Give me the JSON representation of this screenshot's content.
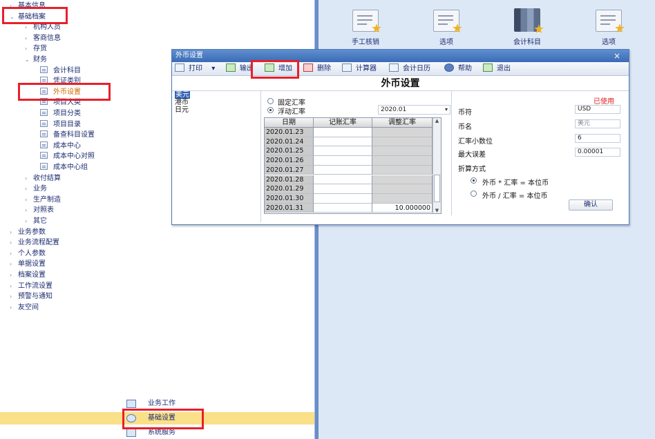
{
  "nav": {
    "items": [
      {
        "label": "基本信息",
        "level": 0,
        "arrow": "›"
      },
      {
        "label": "基础档案",
        "level": 0,
        "arrow": "⌄"
      },
      {
        "label": "机构人员",
        "level": 1,
        "arrow": "›"
      },
      {
        "label": "客商信息",
        "level": 1,
        "arrow": "›"
      },
      {
        "label": "存货",
        "level": 1,
        "arrow": "›"
      },
      {
        "label": "财务",
        "level": 1,
        "arrow": "⌄"
      },
      {
        "label": "会计科目",
        "level": 2
      },
      {
        "label": "凭证类别",
        "level": 2
      },
      {
        "label": "外币设置",
        "level": 2,
        "active": true
      },
      {
        "label": "项目大类",
        "level": 2
      },
      {
        "label": "项目分类",
        "level": 2
      },
      {
        "label": "项目目录",
        "level": 2
      },
      {
        "label": "备查科目设置",
        "level": 2
      },
      {
        "label": "成本中心",
        "level": 2
      },
      {
        "label": "成本中心对照",
        "level": 2
      },
      {
        "label": "成本中心组",
        "level": 2
      },
      {
        "label": "收付结算",
        "level": 1,
        "arrow": "›"
      },
      {
        "label": "业务",
        "level": 1,
        "arrow": "›"
      },
      {
        "label": "生产制造",
        "level": 1,
        "arrow": "›"
      },
      {
        "label": "对照表",
        "level": 1,
        "arrow": "›"
      },
      {
        "label": "其它",
        "level": 1,
        "arrow": "›"
      },
      {
        "label": "业务参数",
        "level": 0,
        "arrow": "›"
      },
      {
        "label": "业务流程配置",
        "level": 0,
        "arrow": "›"
      },
      {
        "label": "个人参数",
        "level": 0,
        "arrow": "›"
      },
      {
        "label": "单据设置",
        "level": 0,
        "arrow": "›"
      },
      {
        "label": "档案设置",
        "level": 0,
        "arrow": "›"
      },
      {
        "label": "工作流设置",
        "level": 0,
        "arrow": "›"
      },
      {
        "label": "预警与通知",
        "level": 0,
        "arrow": "›"
      },
      {
        "label": "友空间",
        "level": 0,
        "arrow": "›"
      }
    ],
    "bottom": [
      {
        "label": "业务工作"
      },
      {
        "label": "基础设置",
        "selected": true
      },
      {
        "label": "系统服务"
      }
    ]
  },
  "desktop": {
    "icons": [
      {
        "label": "手工核销",
        "type": "doc"
      },
      {
        "label": "选项",
        "type": "doc"
      },
      {
        "label": "会计科目",
        "type": "book"
      },
      {
        "label": "选项",
        "type": "doc"
      }
    ]
  },
  "dialog": {
    "title": "外币设置",
    "close": "×",
    "heading": "外币设置",
    "toolbar": {
      "print": "打印",
      "print_dd": "▾",
      "export": "输出",
      "add": "增加",
      "delete": "删除",
      "calculator": "计算器",
      "calendar": "会计日历",
      "help": "帮助",
      "exit": "退出"
    },
    "currencies": [
      {
        "name": "美元",
        "selected": true
      },
      {
        "name": "港币"
      },
      {
        "name": "日元"
      }
    ],
    "rate_type": {
      "fixed": "固定汇率",
      "floating": "浮动汇率",
      "selected": "floating"
    },
    "period": "2020.01",
    "period_dd": "▾",
    "grid": {
      "headers": [
        "日期",
        "记账汇率",
        "调整汇率"
      ],
      "rows": [
        {
          "date": "2020.01.23",
          "book": "",
          "adjust": ""
        },
        {
          "date": "2020.01.24",
          "book": "",
          "adjust": ""
        },
        {
          "date": "2020.01.25",
          "book": "",
          "adjust": ""
        },
        {
          "date": "2020.01.26",
          "book": "",
          "adjust": ""
        },
        {
          "date": "2020.01.27",
          "book": "",
          "adjust": ""
        },
        {
          "date": "2020.01.28",
          "book": "",
          "adjust": ""
        },
        {
          "date": "2020.01.29",
          "book": "",
          "adjust": ""
        },
        {
          "date": "2020.01.30",
          "book": "",
          "adjust": ""
        },
        {
          "date": "2020.01.31",
          "book": "",
          "adjust": "10.000000"
        }
      ],
      "scroll_up": "▲",
      "scroll_down": "▼"
    },
    "in_use": "已使用",
    "fields": {
      "symbol_label": "币符",
      "symbol_value": "USD",
      "name_label": "币名",
      "name_value": "美元",
      "decimals_label": "汇率小数位",
      "decimals_value": "6",
      "max_error_label": "最大误差",
      "max_error_value": "0.00001",
      "method_label": "折算方式",
      "method_multiply": "外币 * 汇率 = 本位币",
      "method_divide": "外币 / 汇率 = 本位币",
      "method_selected": "multiply"
    },
    "confirm": "确认"
  },
  "colors": {
    "highlight_red": "#e8202a",
    "title_bar": "#3a6bb4",
    "in_use": "#e21d1d",
    "active_item": "#d16a00",
    "selected_bottom": "#fbe08a"
  }
}
